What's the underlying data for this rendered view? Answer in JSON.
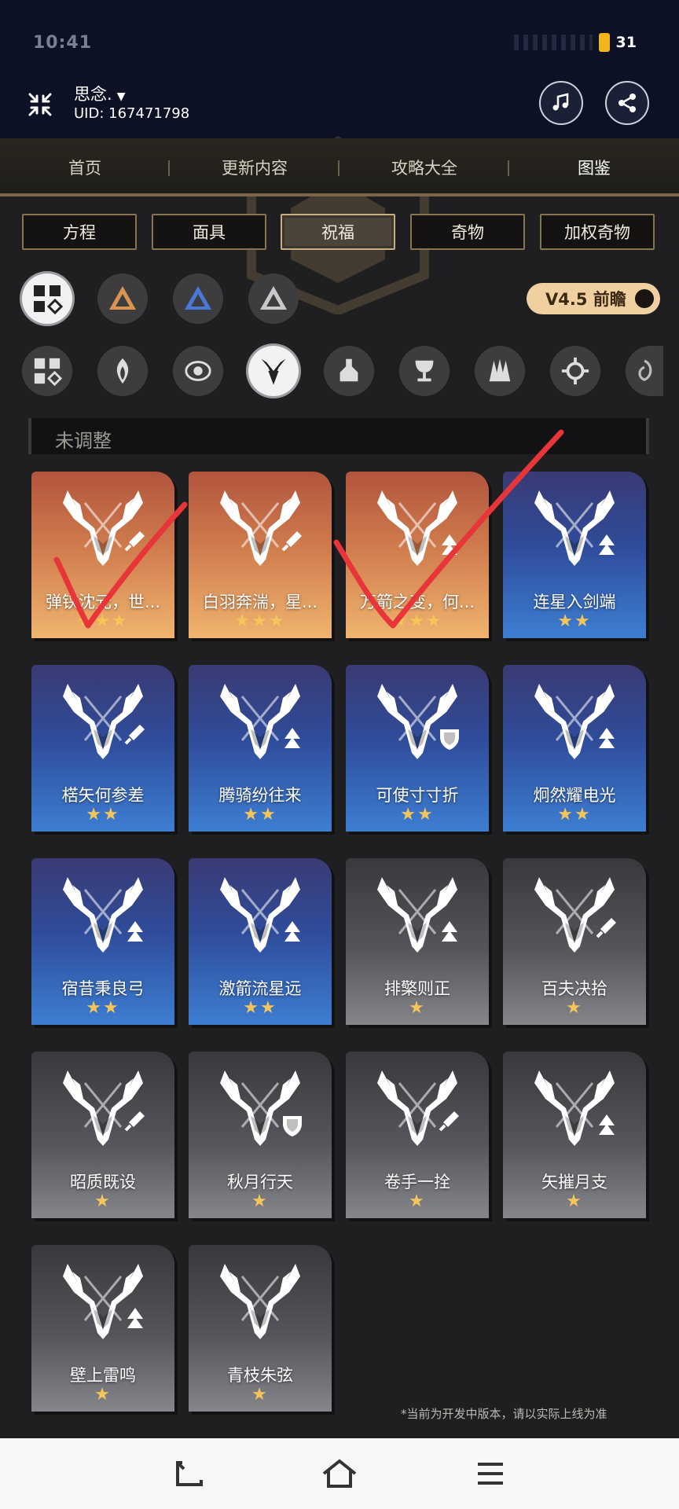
{
  "status": {
    "time": "10:41",
    "battery": "31"
  },
  "header": {
    "user_name": "思念.",
    "uid": "UID: 167471798"
  },
  "nav": {
    "tabs": [
      "首页",
      "更新内容",
      "攻略大全",
      "图鉴"
    ],
    "active": "图鉴"
  },
  "categories": [
    "方程",
    "面具",
    "祝福",
    "奇物",
    "加权奇物"
  ],
  "active_category": "祝福",
  "version_toggle": "V4.5 前瞻",
  "section_title": "未调整",
  "cards": [
    {
      "title": "弹铗沈元，世...",
      "stars": "★★★",
      "tier": "gold"
    },
    {
      "title": "白羽奔湍，星...",
      "stars": "★★★",
      "tier": "gold"
    },
    {
      "title": "万箭之变，何...",
      "stars": "★★★",
      "tier": "gold"
    },
    {
      "title": "连星入剑端",
      "stars": "★★",
      "tier": "blue"
    },
    {
      "title": "楛矢何参差",
      "stars": "★★",
      "tier": "blue"
    },
    {
      "title": "腾骑纷往来",
      "stars": "★★",
      "tier": "blue"
    },
    {
      "title": "可使寸寸折",
      "stars": "★★",
      "tier": "blue"
    },
    {
      "title": "炯然耀电光",
      "stars": "★★",
      "tier": "blue"
    },
    {
      "title": "宿昔秉良弓",
      "stars": "★★",
      "tier": "blue"
    },
    {
      "title": "激箭流星远",
      "stars": "★★",
      "tier": "blue"
    },
    {
      "title": "排檠则正",
      "stars": "★",
      "tier": "gray"
    },
    {
      "title": "百夫决拾",
      "stars": "★",
      "tier": "gray"
    },
    {
      "title": "昭质既设",
      "stars": "★",
      "tier": "gray"
    },
    {
      "title": "秋月行天",
      "stars": "★",
      "tier": "gray"
    },
    {
      "title": "卷手一拴",
      "stars": "★",
      "tier": "gray"
    },
    {
      "title": "矢摧月支",
      "stars": "★",
      "tier": "gray"
    },
    {
      "title": "壁上雷鸣",
      "stars": "★",
      "tier": "gray"
    },
    {
      "title": "青枝朱弦",
      "stars": "★",
      "tier": "gray"
    }
  ],
  "footer_note": "*当前为开发中版本，请以实际上线为准",
  "colors": {
    "accent_gold": "#f0cfa0",
    "check_red": "#e8353a"
  }
}
